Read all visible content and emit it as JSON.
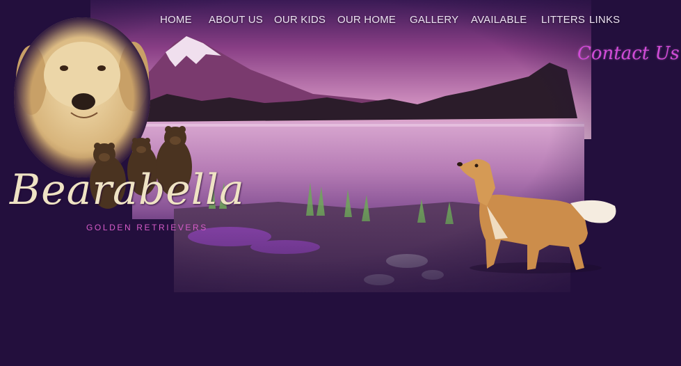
{
  "nav": {
    "home": "HOME",
    "about_us": "ABOUT US",
    "our_kids": "OUR KIDS",
    "our_home": "OUR HOME",
    "gallery": "GALLERY",
    "available": "AVAILABLE",
    "litters": "LITTERS",
    "links": "LINKS"
  },
  "contact_label": "Contact Us",
  "logo": {
    "name": "Bearabella",
    "tagline": "GOLDEN RETRIEVERS"
  },
  "colors": {
    "background": "#230f3d",
    "nav_text": "#eee3f4",
    "contact": "#d24bd8",
    "logo_text": "#efe3c4",
    "tagline": "#d65cc8"
  }
}
